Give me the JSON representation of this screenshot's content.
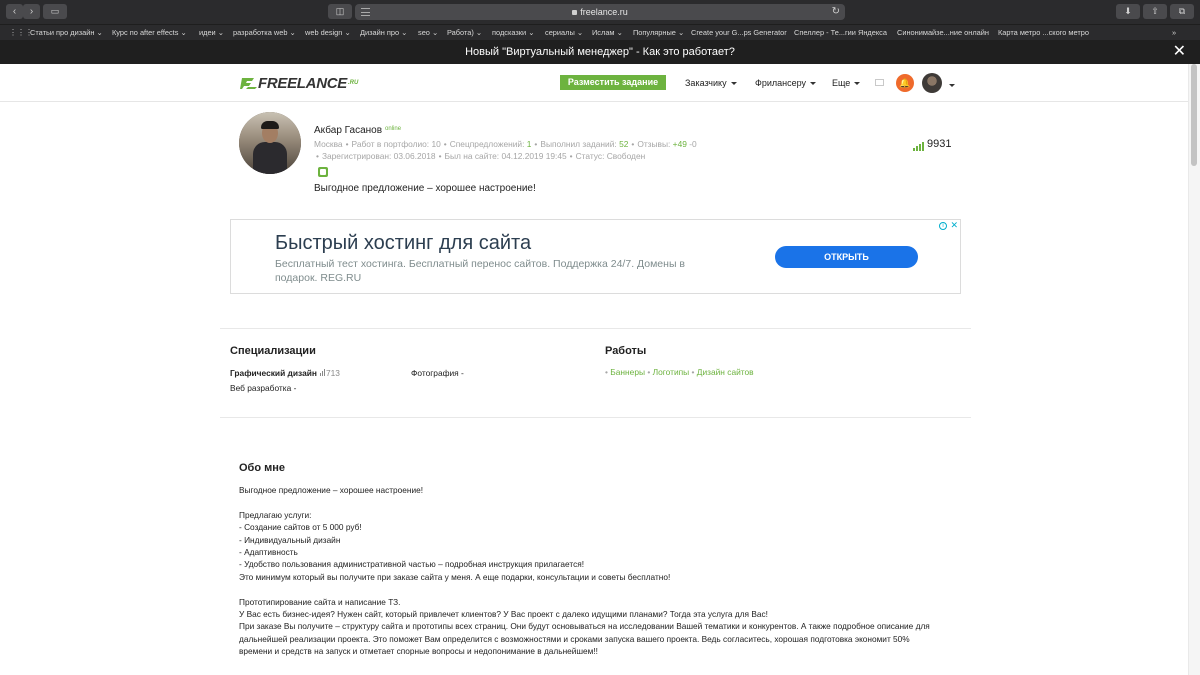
{
  "browser": {
    "url": "freelance.ru",
    "bookmarks": [
      "Статьи про дизайн",
      "Курс по after effects",
      "идеи",
      "разработка web",
      "web design",
      "Дизайн про",
      "seo",
      "Работа)",
      "подсказки",
      "сериалы",
      "Ислам",
      "Популярные",
      "Create your G...ps Generator",
      "Спеллер - Те...гии Яндекса",
      "Синонимайзе...ние онлайн",
      "Карта метро ...ского метро"
    ]
  },
  "banner": {
    "text": "Новый \"Виртуальный менеджер\" - Как это работает?"
  },
  "header": {
    "logo_text": "FREELANCE",
    "logo_sup": ".RU",
    "post_task": "Разместить задание",
    "menu_customer": "Заказчику",
    "menu_freelancer": "Фрилансеру",
    "menu_more": "Еще",
    "accent_color": "#6db33f"
  },
  "profile": {
    "name": "Акбар Гасанов",
    "status": "online",
    "city": "Москва",
    "portfolio_label": "Работ в портфолио: ",
    "portfolio_value": "10",
    "offers_label": "Спецпредложений: ",
    "offers_value": "1",
    "done_label": "Выполнил заданий: ",
    "done_value": "52",
    "reviews_label": "Отзывы: ",
    "reviews_pos": "+49",
    "reviews_neg": "-0",
    "registered": "Зарегистрирован: 03.06.2018",
    "last_seen": "Был на сайте: 04.12.2019 19:45",
    "state": "Статус: Свободен",
    "slogan": "Выгодное предложение – хорошее настроение!",
    "rating": "9931"
  },
  "ad": {
    "title": "Быстрый хостинг для сайта",
    "description": "Бесплатный тест хостинга. Бесплатный перенос сайтов. Поддержка 24/7. Домены в подарок. REG.RU",
    "button": "ОТКРЫТЬ"
  },
  "specializations": {
    "title": "Специализации",
    "items": [
      {
        "name": "Графический дизайн",
        "count": "713"
      },
      {
        "name": "Фотография",
        "suffix": "-"
      },
      {
        "name": "Веб разработка",
        "suffix": "-"
      }
    ]
  },
  "works": {
    "title": "Работы",
    "items": [
      "Баннеры",
      "Логотипы",
      "Дизайн сайтов"
    ]
  },
  "about": {
    "title": "Обо мне",
    "paragraphs": [
      "Выгодное предложение – хорошее настроение!",
      "",
      "Предлагаю услуги:",
      "- Создание сайтов от 5 000 руб!",
      "- Индивидуальный дизайн",
      "- Адаптивность",
      "- Удобство пользования административной частью – подробная инструкция прилагается!",
      "Это минимум который вы получите при заказе сайта у меня. А еще подарки, консультации и советы бесплатно!",
      "",
      "Прототипирование сайта и написание ТЗ.",
      "У Вас есть бизнес-идея? Нужен сайт, который привлечет клиентов? У Вас проект с далеко идущими планами? Тогда эта услуга для Вас!",
      "При заказе Вы получите – структуру сайта и прототипы всех страниц. Они будут основываться на исследовании Вашей тематики и конкурентов. А также подробное описание для дальнейшей реализации проекта. Это поможет Вам определится с возможностями и сроками запуска вашего проекта. Ведь согласитесь, хорошая подготовка экономит 50% времени и средств на запуск и отметает спорные вопросы и недопонимание в дальнейшем!!"
    ]
  }
}
